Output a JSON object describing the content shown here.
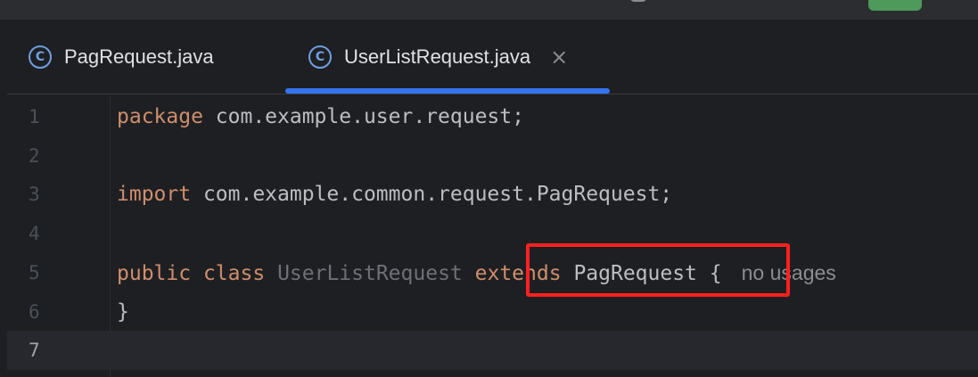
{
  "tabs": [
    {
      "label": "PagRequest.java",
      "icon": "class-icon",
      "icon_glyph": "C",
      "active": false
    },
    {
      "label": "UserListRequest.java",
      "icon": "class-icon",
      "icon_glyph": "C",
      "active": true,
      "close": "×"
    }
  ],
  "lines": [
    {
      "num": "1",
      "kw1": "package",
      "rest": " com.example.user.request;"
    },
    {
      "num": "2"
    },
    {
      "num": "3",
      "kw1": "import",
      "rest": " com.example.common.request.PagRequest;"
    },
    {
      "num": "4"
    },
    {
      "num": "5",
      "kw1": "public",
      "kw2": "class",
      "classname": "UserListRequest",
      "kw3": "extends",
      "parent": "PagRequest",
      "brace": "{",
      "hint": "no usages"
    },
    {
      "num": "6",
      "rest": "}"
    },
    {
      "num": "7"
    }
  ],
  "colors": {
    "accent": "#3574f0",
    "keyword": "#cf8e6d",
    "highlight": "#ff2020"
  }
}
